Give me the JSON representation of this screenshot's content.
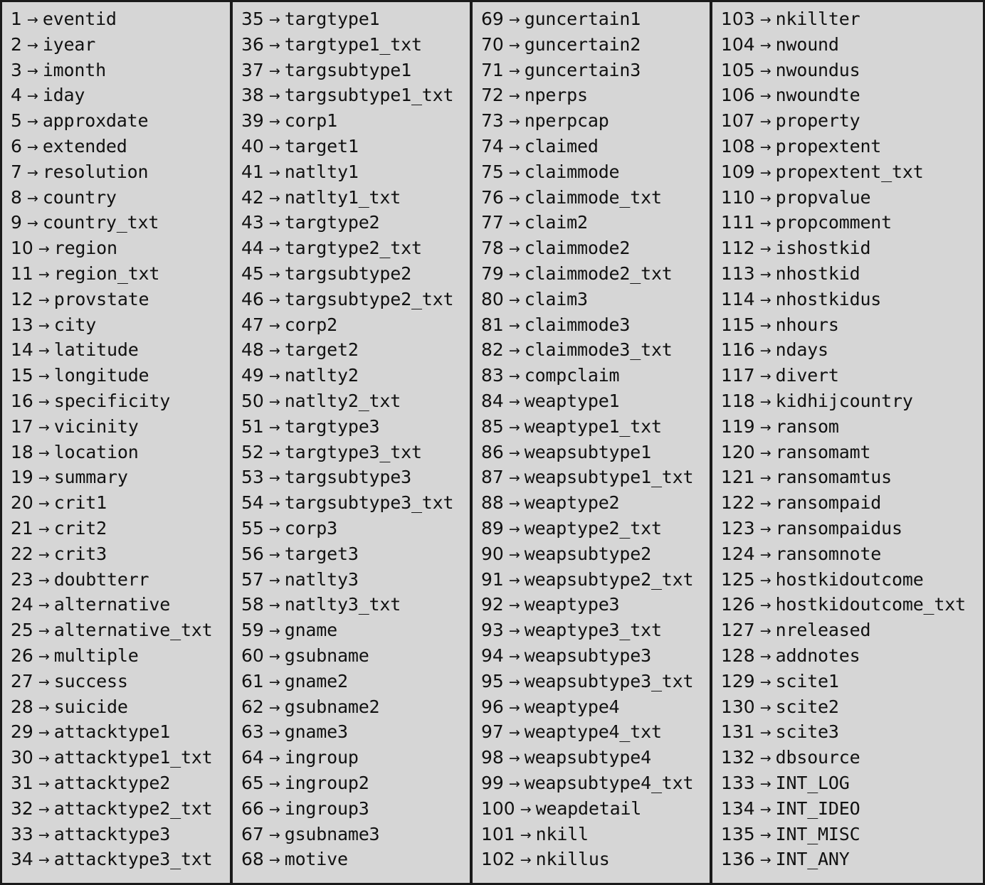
{
  "view": {
    "title": "GTD field index listing",
    "arrow_glyph": "→",
    "background_color": "#d6d6d6",
    "border_color": "#1a1a1a",
    "text_color": "#111111",
    "column_count": 4,
    "total_fields": 136
  },
  "columns": [
    {
      "name": "column-1",
      "rows": [
        {
          "number": "1",
          "label": "eventid"
        },
        {
          "number": "2",
          "label": "iyear"
        },
        {
          "number": "3",
          "label": "imonth"
        },
        {
          "number": "4",
          "label": "iday"
        },
        {
          "number": "5",
          "label": "approxdate"
        },
        {
          "number": "6",
          "label": "extended"
        },
        {
          "number": "7",
          "label": "resolution"
        },
        {
          "number": "8",
          "label": "country"
        },
        {
          "number": "9",
          "label": "country_txt"
        },
        {
          "number": "10",
          "label": "region"
        },
        {
          "number": "11",
          "label": "region_txt"
        },
        {
          "number": "12",
          "label": "provstate"
        },
        {
          "number": "13",
          "label": "city"
        },
        {
          "number": "14",
          "label": "latitude"
        },
        {
          "number": "15",
          "label": "longitude"
        },
        {
          "number": "16",
          "label": "specificity"
        },
        {
          "number": "17",
          "label": "vicinity"
        },
        {
          "number": "18",
          "label": "location"
        },
        {
          "number": "19",
          "label": "summary"
        },
        {
          "number": "20",
          "label": "crit1"
        },
        {
          "number": "21",
          "label": "crit2"
        },
        {
          "number": "22",
          "label": "crit3"
        },
        {
          "number": "23",
          "label": "doubtterr"
        },
        {
          "number": "24",
          "label": "alternative"
        },
        {
          "number": "25",
          "label": "alternative_txt"
        },
        {
          "number": "26",
          "label": "multiple"
        },
        {
          "number": "27",
          "label": "success"
        },
        {
          "number": "28",
          "label": "suicide"
        },
        {
          "number": "29",
          "label": "attacktype1"
        },
        {
          "number": "30",
          "label": "attacktype1_txt"
        },
        {
          "number": "31",
          "label": "attacktype2"
        },
        {
          "number": "32",
          "label": "attacktype2_txt"
        },
        {
          "number": "33",
          "label": "attacktype3"
        },
        {
          "number": "34",
          "label": "attacktype3_txt"
        }
      ]
    },
    {
      "name": "column-2",
      "rows": [
        {
          "number": "35",
          "label": "targtype1"
        },
        {
          "number": "36",
          "label": "targtype1_txt"
        },
        {
          "number": "37",
          "label": "targsubtype1"
        },
        {
          "number": "38",
          "label": "targsubtype1_txt"
        },
        {
          "number": "39",
          "label": "corp1"
        },
        {
          "number": "40",
          "label": "target1"
        },
        {
          "number": "41",
          "label": "natlty1"
        },
        {
          "number": "42",
          "label": "natlty1_txt"
        },
        {
          "number": "43",
          "label": "targtype2"
        },
        {
          "number": "44",
          "label": "targtype2_txt"
        },
        {
          "number": "45",
          "label": "targsubtype2"
        },
        {
          "number": "46",
          "label": "targsubtype2_txt"
        },
        {
          "number": "47",
          "label": "corp2"
        },
        {
          "number": "48",
          "label": "target2"
        },
        {
          "number": "49",
          "label": "natlty2"
        },
        {
          "number": "50",
          "label": "natlty2_txt"
        },
        {
          "number": "51",
          "label": "targtype3"
        },
        {
          "number": "52",
          "label": "targtype3_txt"
        },
        {
          "number": "53",
          "label": "targsubtype3"
        },
        {
          "number": "54",
          "label": "targsubtype3_txt"
        },
        {
          "number": "55",
          "label": "corp3"
        },
        {
          "number": "56",
          "label": "target3"
        },
        {
          "number": "57",
          "label": "natlty3"
        },
        {
          "number": "58",
          "label": "natlty3_txt"
        },
        {
          "number": "59",
          "label": "gname"
        },
        {
          "number": "60",
          "label": "gsubname"
        },
        {
          "number": "61",
          "label": "gname2"
        },
        {
          "number": "62",
          "label": "gsubname2"
        },
        {
          "number": "63",
          "label": "gname3"
        },
        {
          "number": "64",
          "label": "ingroup"
        },
        {
          "number": "65",
          "label": "ingroup2"
        },
        {
          "number": "66",
          "label": "ingroup3"
        },
        {
          "number": "67",
          "label": "gsubname3"
        },
        {
          "number": "68",
          "label": "motive"
        }
      ]
    },
    {
      "name": "column-3",
      "rows": [
        {
          "number": "69",
          "label": "guncertain1"
        },
        {
          "number": "70",
          "label": "guncertain2"
        },
        {
          "number": "71",
          "label": "guncertain3"
        },
        {
          "number": "72",
          "label": "nperps"
        },
        {
          "number": "73",
          "label": "nperpcap"
        },
        {
          "number": "74",
          "label": "claimed"
        },
        {
          "number": "75",
          "label": "claimmode"
        },
        {
          "number": "76",
          "label": "claimmode_txt"
        },
        {
          "number": "77",
          "label": "claim2"
        },
        {
          "number": "78",
          "label": "claimmode2"
        },
        {
          "number": "79",
          "label": "claimmode2_txt"
        },
        {
          "number": "80",
          "label": "claim3"
        },
        {
          "number": "81",
          "label": "claimmode3"
        },
        {
          "number": "82",
          "label": "claimmode3_txt"
        },
        {
          "number": "83",
          "label": "compclaim"
        },
        {
          "number": "84",
          "label": "weaptype1"
        },
        {
          "number": "85",
          "label": "weaptype1_txt"
        },
        {
          "number": "86",
          "label": "weapsubtype1"
        },
        {
          "number": "87",
          "label": "weapsubtype1_txt"
        },
        {
          "number": "88",
          "label": "weaptype2"
        },
        {
          "number": "89",
          "label": "weaptype2_txt"
        },
        {
          "number": "90",
          "label": "weapsubtype2"
        },
        {
          "number": "91",
          "label": "weapsubtype2_txt"
        },
        {
          "number": "92",
          "label": "weaptype3"
        },
        {
          "number": "93",
          "label": "weaptype3_txt"
        },
        {
          "number": "94",
          "label": "weapsubtype3"
        },
        {
          "number": "95",
          "label": "weapsubtype3_txt"
        },
        {
          "number": "96",
          "label": "weaptype4"
        },
        {
          "number": "97",
          "label": "weaptype4_txt"
        },
        {
          "number": "98",
          "label": "weapsubtype4"
        },
        {
          "number": "99",
          "label": "weapsubtype4_txt"
        },
        {
          "number": "100",
          "label": "weapdetail"
        },
        {
          "number": "101",
          "label": "nkill"
        },
        {
          "number": "102",
          "label": "nkillus"
        }
      ]
    },
    {
      "name": "column-4",
      "rows": [
        {
          "number": "103",
          "label": "nkillter"
        },
        {
          "number": "104",
          "label": "nwound"
        },
        {
          "number": "105",
          "label": "nwoundus"
        },
        {
          "number": "106",
          "label": "nwoundte"
        },
        {
          "number": "107",
          "label": "property"
        },
        {
          "number": "108",
          "label": "propextent"
        },
        {
          "number": "109",
          "label": "propextent_txt"
        },
        {
          "number": "110",
          "label": "propvalue"
        },
        {
          "number": "111",
          "label": "propcomment"
        },
        {
          "number": "112",
          "label": "ishostkid"
        },
        {
          "number": "113",
          "label": "nhostkid"
        },
        {
          "number": "114",
          "label": "nhostkidus"
        },
        {
          "number": "115",
          "label": "nhours"
        },
        {
          "number": "116",
          "label": "ndays"
        },
        {
          "number": "117",
          "label": "divert"
        },
        {
          "number": "118",
          "label": "kidhijcountry"
        },
        {
          "number": "119",
          "label": "ransom"
        },
        {
          "number": "120",
          "label": "ransomamt"
        },
        {
          "number": "121",
          "label": "ransomamtus"
        },
        {
          "number": "122",
          "label": "ransompaid"
        },
        {
          "number": "123",
          "label": "ransompaidus"
        },
        {
          "number": "124",
          "label": "ransomnote"
        },
        {
          "number": "125",
          "label": "hostkidoutcome"
        },
        {
          "number": "126",
          "label": "hostkidoutcome_txt"
        },
        {
          "number": "127",
          "label": "nreleased"
        },
        {
          "number": "128",
          "label": "addnotes"
        },
        {
          "number": "129",
          "label": "scite1"
        },
        {
          "number": "130",
          "label": "scite2"
        },
        {
          "number": "131",
          "label": "scite3"
        },
        {
          "number": "132",
          "label": "dbsource"
        },
        {
          "number": "133",
          "label": "INT_LOG"
        },
        {
          "number": "134",
          "label": "INT_IDEO"
        },
        {
          "number": "135",
          "label": "INT_MISC"
        },
        {
          "number": "136",
          "label": "INT_ANY"
        }
      ]
    }
  ]
}
